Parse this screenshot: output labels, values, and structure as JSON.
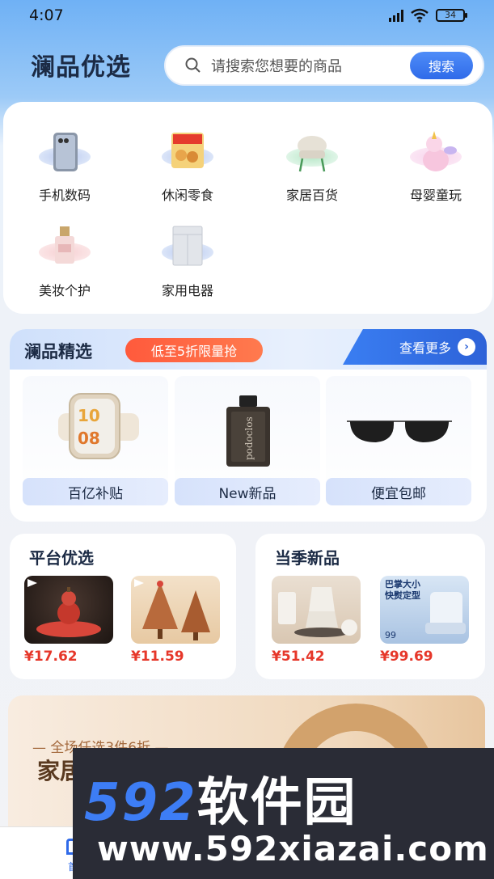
{
  "status_bar": {
    "time": "4:07",
    "battery": "34"
  },
  "header": {
    "app_title": "澜品优选",
    "search_placeholder": "请搜索您想要的商品",
    "search_button": "搜索"
  },
  "categories": [
    {
      "label": "手机数码",
      "icon": "phone-icon"
    },
    {
      "label": "休闲零食",
      "icon": "snack-icon"
    },
    {
      "label": "家居百货",
      "icon": "chair-icon"
    },
    {
      "label": "母婴童玩",
      "icon": "unicorn-toy-icon"
    },
    {
      "label": "美妆个护",
      "icon": "perfume-icon"
    },
    {
      "label": "家用电器",
      "icon": "appliance-icon"
    }
  ],
  "featured": {
    "title": "澜品精选",
    "promo": "低至5折限量抢",
    "more": "查看更多",
    "items": [
      {
        "label": "百亿补贴",
        "icon": "smartwatch-icon"
      },
      {
        "label": "New新品",
        "icon": "cologne-bottle-icon"
      },
      {
        "label": "便宜包邮",
        "icon": "sunglasses-icon"
      }
    ]
  },
  "platform_pick": {
    "title": "平台优选",
    "products": [
      {
        "price": "¥17.62",
        "image": "gourd-ornament-image"
      },
      {
        "price": "¥11.59",
        "image": "wooden-trees-image"
      }
    ]
  },
  "seasonal_new": {
    "title": "当季新品",
    "products": [
      {
        "price": "¥51.42",
        "image": "moka-pot-image"
      },
      {
        "price": "¥99.69",
        "image": "product-box-image",
        "box_title": "巴掌大小 快熨定型",
        "box_price": "99"
      }
    ]
  },
  "banner": {
    "subtitle": "— 全场任选3件6折 —",
    "title": "家居"
  },
  "bottom_nav": {
    "home_label": "首"
  },
  "watermark": {
    "brand_num": "592",
    "brand_text": "软件园",
    "url": "www.592xiazai.com"
  },
  "colors": {
    "accent": "#2f6ae9",
    "price": "#e6372a",
    "promo": "#ff5a3c"
  }
}
